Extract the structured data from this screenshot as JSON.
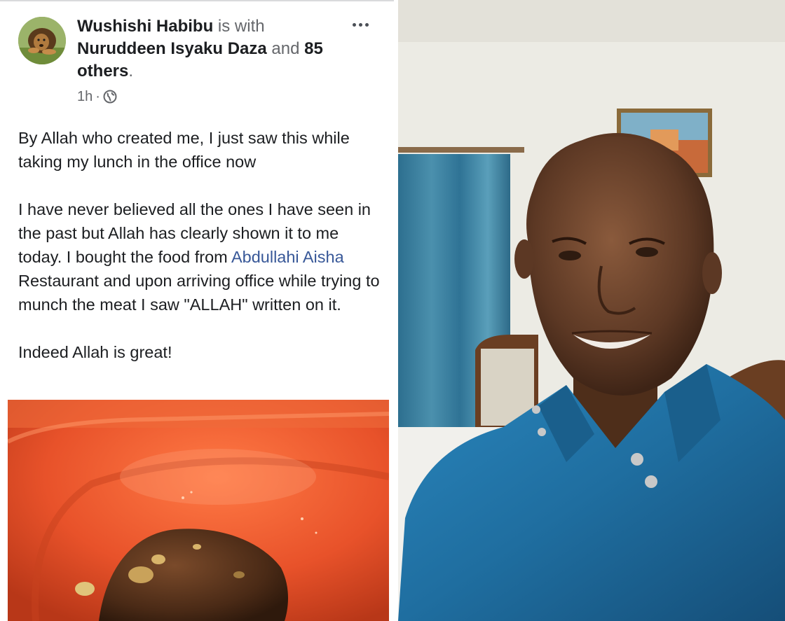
{
  "post": {
    "author": "Wushishi Habibu",
    "with_word": " is with ",
    "tagged_person": "Nuruddeen Isyaku Daza",
    "and_word": " and ",
    "others": "85 others",
    "period": ".",
    "time": "1h",
    "separator": "·",
    "privacy_icon": "globe-icon",
    "more_icon": "ellipsis-icon",
    "paragraph_1": "By Allah who created me, I just saw this while taking my lunch in the office now",
    "paragraph_2_before": "I have never believed all the ones I have seen in the past but Allah has clearly shown it to me today. I bought the food from ",
    "paragraph_2_mention": "Abdullahi Aisha",
    "paragraph_2_after": " Restaurant and upon arriving office while trying to munch the meat I saw \"ALLAH\" written on it.",
    "paragraph_3": "Indeed Allah is great!"
  },
  "colors": {
    "link": "#385898",
    "text": "#1c1e21",
    "muted": "#65676b",
    "plate": "#e8522a",
    "shirt": "#1f6ea0"
  }
}
